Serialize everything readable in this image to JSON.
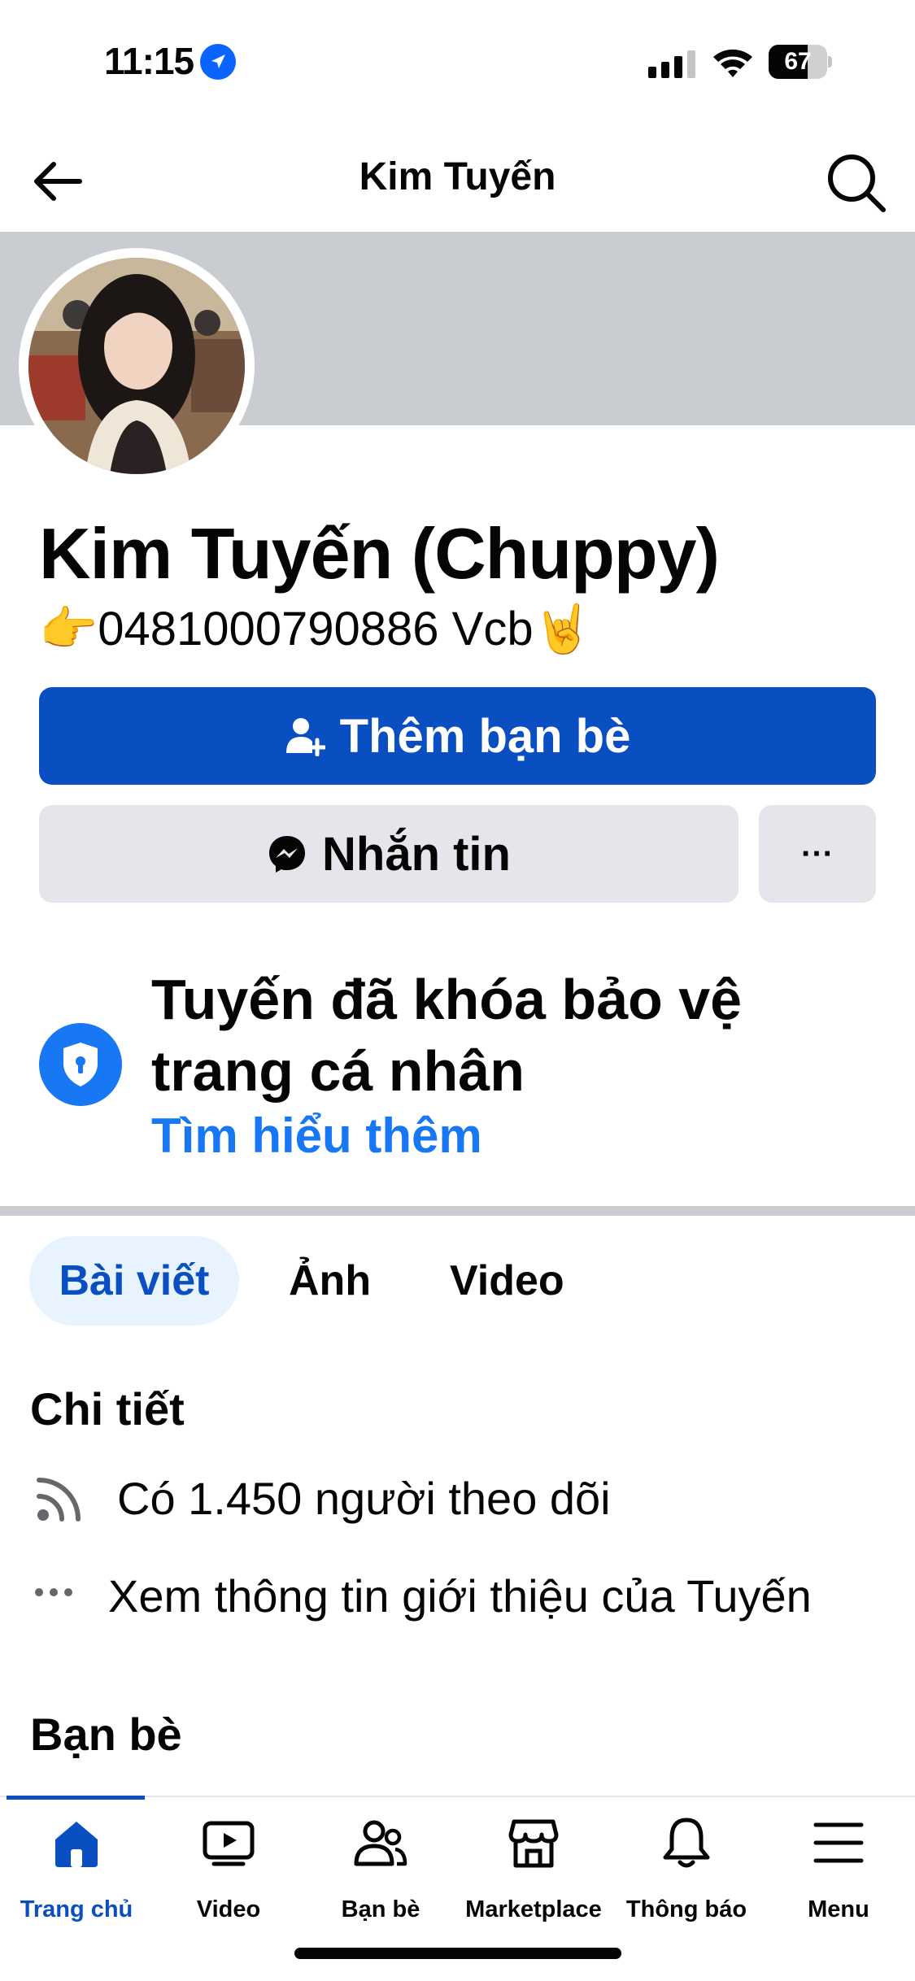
{
  "status_bar": {
    "time": "11:15",
    "battery": "67",
    "battery_level": 0.67
  },
  "header": {
    "title": "Kim Tuyến"
  },
  "profile": {
    "name": "Kim Tuyến (Chuppy)",
    "bio": "👉0481000790886 Vcb🤘"
  },
  "actions": {
    "add_friend": "Thêm bạn bè",
    "message": "Nhắn tin",
    "more": "···"
  },
  "lock_notice": {
    "title": "Tuyến đã khóa bảo vệ trang cá nhân",
    "link": "Tìm hiểu thêm"
  },
  "tabs": [
    {
      "label": "Bài viết",
      "active": true
    },
    {
      "label": "Ảnh",
      "active": false
    },
    {
      "label": "Video",
      "active": false
    }
  ],
  "details": {
    "title": "Chi tiết",
    "followers": "Có 1.450 người theo dõi",
    "about": "Xem thông tin giới thiệu của Tuyến"
  },
  "friends": {
    "title": "Bạn bè"
  },
  "bottom_nav": [
    {
      "label": "Trang chủ",
      "icon": "home-icon",
      "active": true
    },
    {
      "label": "Video",
      "icon": "video-icon",
      "active": false
    },
    {
      "label": "Bạn bè",
      "icon": "friends-icon",
      "active": false
    },
    {
      "label": "Marketplace",
      "icon": "marketplace-icon",
      "active": false
    },
    {
      "label": "Thông báo",
      "icon": "bell-icon",
      "active": false
    },
    {
      "label": "Menu",
      "icon": "menu-icon",
      "active": false
    }
  ],
  "colors": {
    "accent": "#0a4fc1",
    "link": "#1877f2",
    "button_gray": "#e4e6eb",
    "cover": "#c9ccd1"
  }
}
